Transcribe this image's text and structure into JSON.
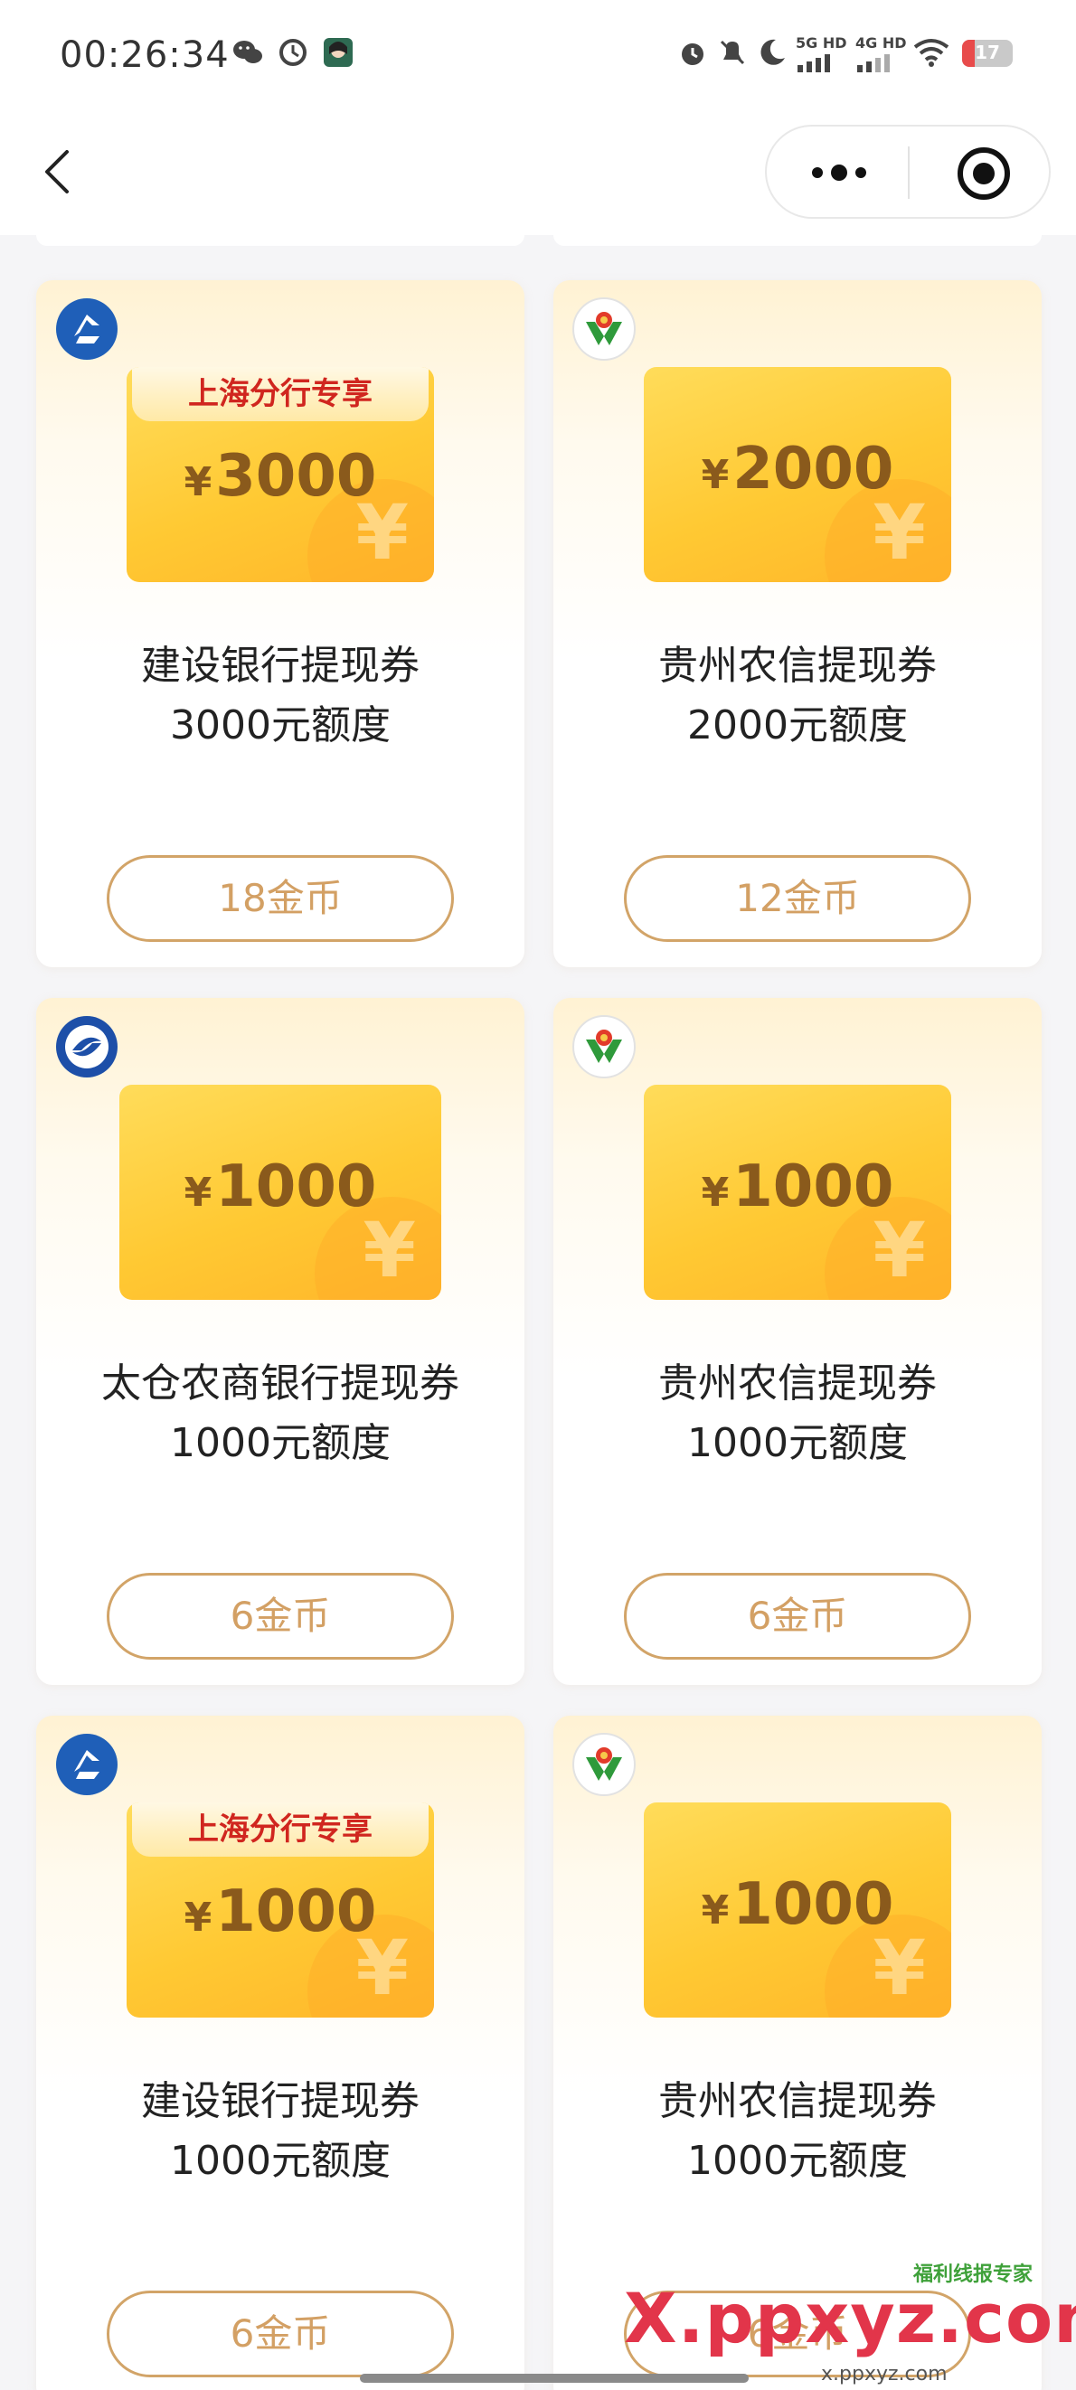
{
  "status_bar": {
    "time": "00:26:34",
    "network_1": "5G HD",
    "network_2": "4G HD",
    "battery": "17"
  },
  "nav": {
    "back_icon": "chevron-left-icon",
    "more_icon": "more-dots-icon",
    "close_icon": "target-close-icon"
  },
  "cards": [
    {
      "bank": "China Construction Bank",
      "logo": "ccb-logo-icon",
      "ribbon": "上海分行专享",
      "currency": "¥",
      "amount": "3000",
      "title": "建设银行提现券",
      "subtitle": "3000元额度",
      "price": "18金币"
    },
    {
      "bank": "Guizhou Rural Credit",
      "logo": "guizhou-rcc-logo-icon",
      "ribbon": "",
      "currency": "¥",
      "amount": "2000",
      "title": "贵州农信提现券",
      "subtitle": "2000元额度",
      "price": "12金币"
    },
    {
      "bank": "Taicang Rural Commercial Bank",
      "logo": "taicang-logo-icon",
      "ribbon": "",
      "currency": "¥",
      "amount": "1000",
      "title": "太仓农商银行提现券",
      "subtitle": "1000元额度",
      "price": "6金币"
    },
    {
      "bank": "Guizhou Rural Credit",
      "logo": "guizhou-rcc-logo-icon",
      "ribbon": "",
      "currency": "¥",
      "amount": "1000",
      "title": "贵州农信提现券",
      "subtitle": "1000元额度",
      "price": "6金币"
    },
    {
      "bank": "China Construction Bank",
      "logo": "ccb-logo-icon",
      "ribbon": "上海分行专享",
      "currency": "¥",
      "amount": "1000",
      "title": "建设银行提现券",
      "subtitle": "1000元额度",
      "price": "6金币"
    },
    {
      "bank": "Guizhou Rural Credit",
      "logo": "guizhou-rcc-logo-icon",
      "ribbon": "",
      "currency": "¥",
      "amount": "1000",
      "title": "贵州农信提现券",
      "subtitle": "1000元额度",
      "price": "6金币"
    }
  ],
  "watermark": {
    "text": "X.ppxyz.com",
    "subtitle": "福利线报专家",
    "domain": "x.ppxyz.com"
  },
  "colors": {
    "accent_border": "#d2a468",
    "price_text": "#d3a064",
    "coupon_yellow": "#ffc933",
    "ribbon_red": "#d0261f"
  }
}
